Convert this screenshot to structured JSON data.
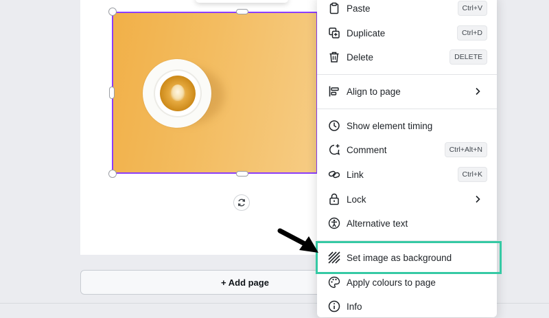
{
  "canvas": {
    "add_page_label": "+ Add page"
  },
  "context_menu": {
    "items": [
      {
        "label": "Paste",
        "shortcut": "Ctrl+V",
        "icon": "clipboard-icon"
      },
      {
        "label": "Duplicate",
        "shortcut": "Ctrl+D",
        "icon": "duplicate-icon"
      },
      {
        "label": "Delete",
        "shortcut": "DELETE",
        "icon": "trash-icon"
      },
      {
        "label": "Align to page",
        "shortcut": "",
        "icon": "align-left-icon",
        "submenu": true
      },
      {
        "label": "Show element timing",
        "shortcut": "",
        "icon": "clock-icon"
      },
      {
        "label": "Comment",
        "shortcut": "Ctrl+Alt+N",
        "icon": "comment-add-icon"
      },
      {
        "label": "Link",
        "shortcut": "Ctrl+K",
        "icon": "link-icon"
      },
      {
        "label": "Lock",
        "shortcut": "",
        "icon": "lock-icon",
        "submenu": true
      },
      {
        "label": "Alternative text",
        "shortcut": "",
        "icon": "accessibility-icon"
      },
      {
        "label": "Set image as background",
        "shortcut": "",
        "icon": "background-hatch-icon",
        "highlighted": true
      },
      {
        "label": "Apply colours to page",
        "shortcut": "",
        "icon": "palette-icon"
      },
      {
        "label": "Info",
        "shortcut": "",
        "icon": "info-icon"
      }
    ]
  },
  "colors": {
    "selection_border": "#8b3dff",
    "highlight_box": "#35c9a4",
    "canvas_bg": "#ebecf0"
  }
}
